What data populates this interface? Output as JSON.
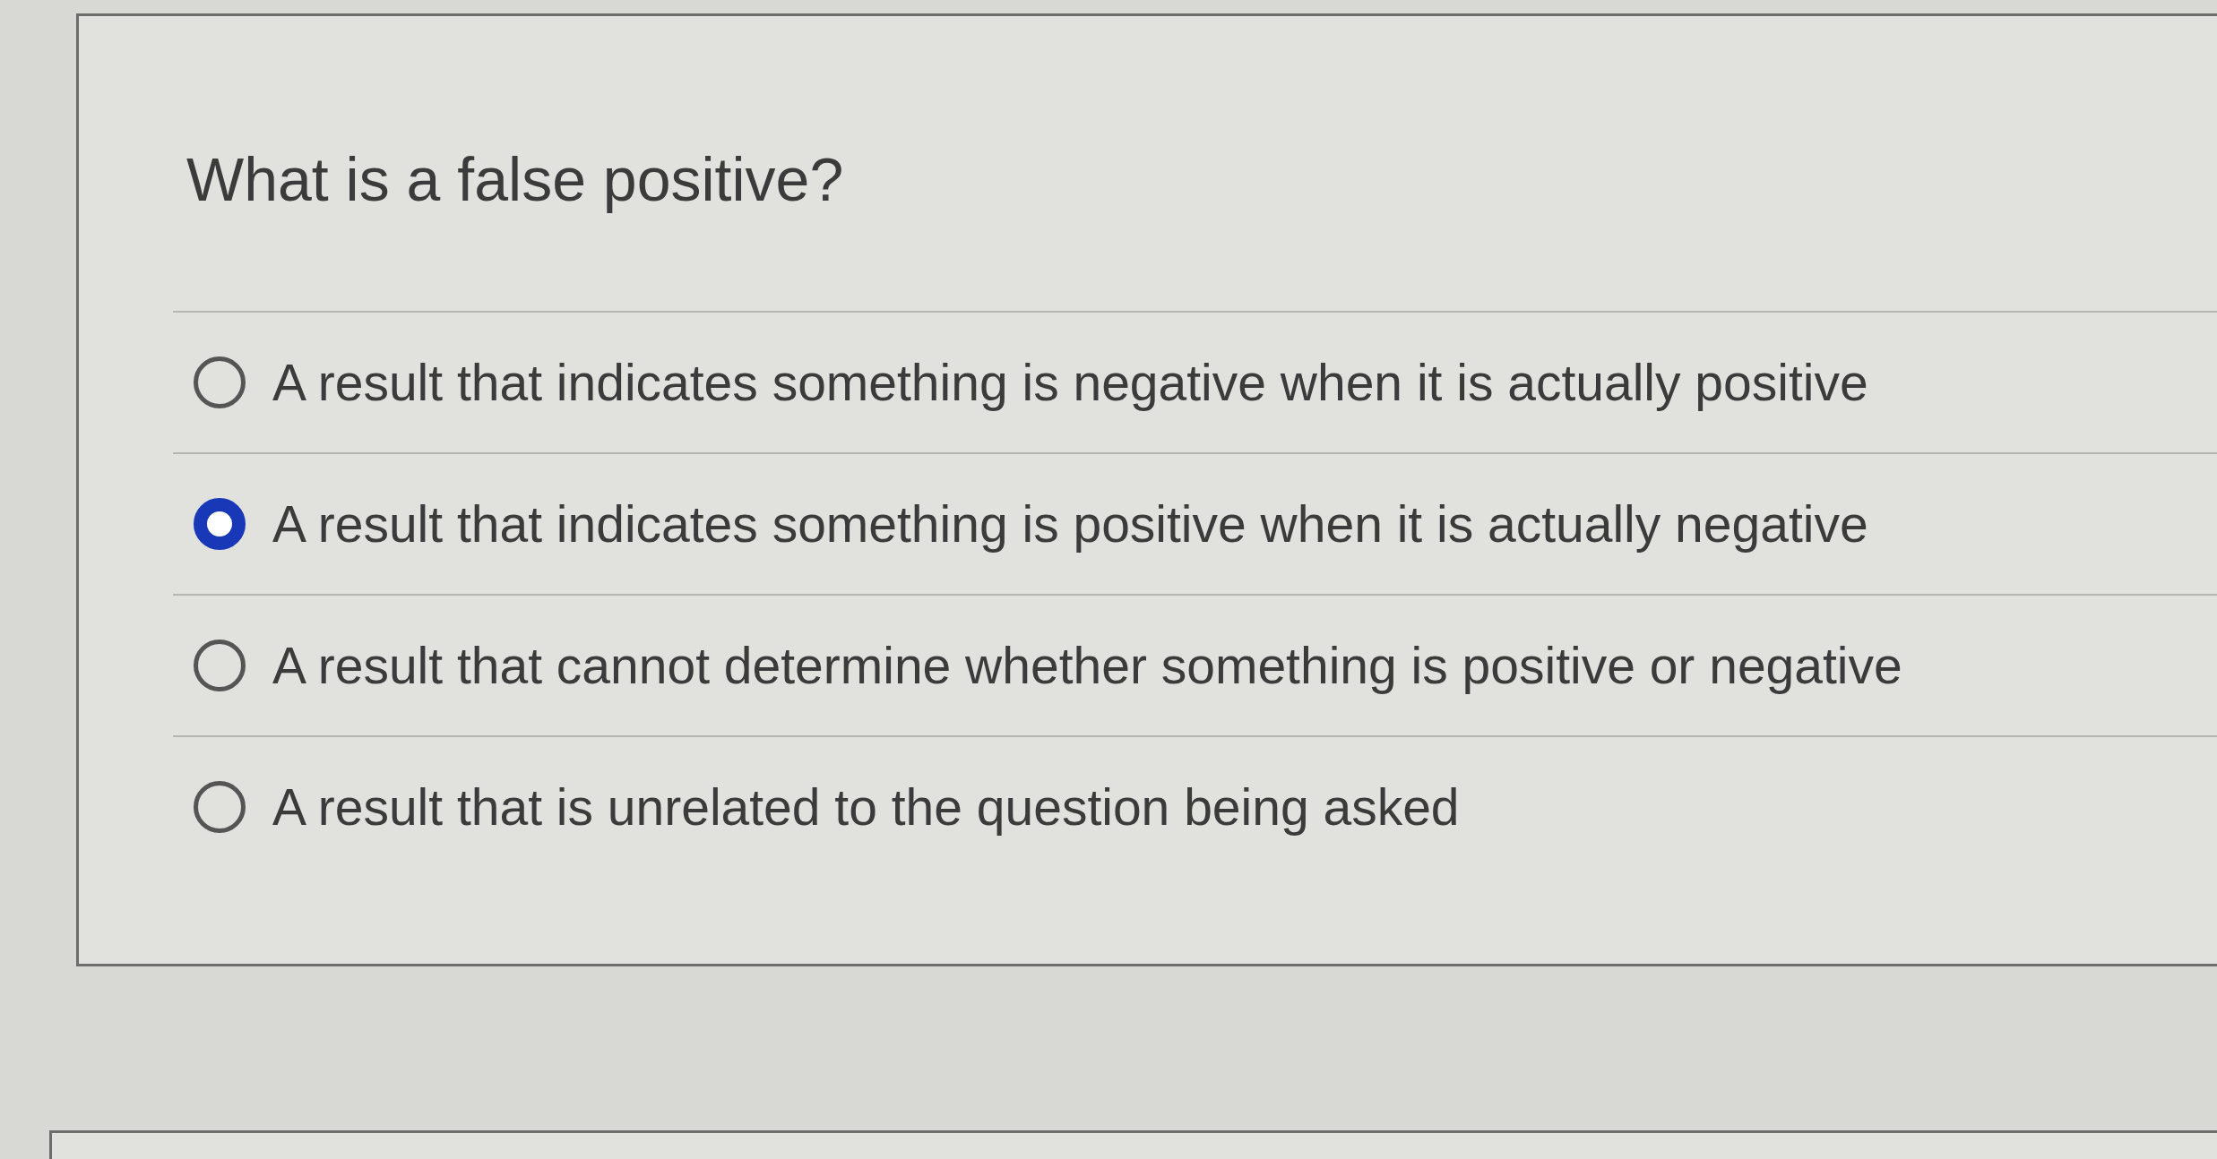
{
  "question": {
    "text": "What is a false positive?"
  },
  "options": [
    {
      "label": "A result that indicates something is negative when it is actually positive",
      "selected": false
    },
    {
      "label": "A result that indicates something is positive when it is actually negative",
      "selected": true
    },
    {
      "label": "A result that cannot determine whether something is positive or negative",
      "selected": false
    },
    {
      "label": "A result that is unrelated to the question being asked",
      "selected": false
    }
  ]
}
